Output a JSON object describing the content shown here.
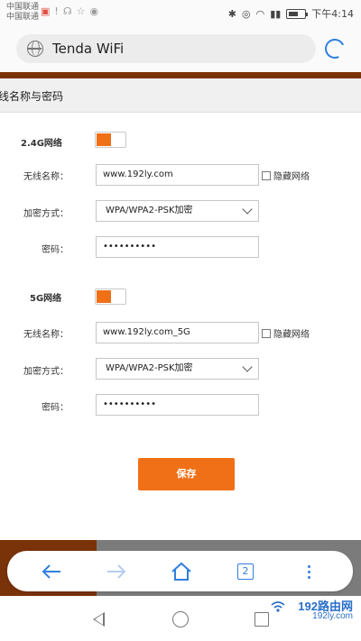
{
  "status_bar": {
    "carrier1": "中国联通",
    "carrier2": "中国联通",
    "time": "下午4:14"
  },
  "browser": {
    "url_text": "Tenda WiFi",
    "tab_count": "2"
  },
  "page": {
    "section_title": "线名称与密码",
    "band_24": {
      "label": "2.4G网络",
      "enabled": true,
      "ssid_label": "无线名称：",
      "ssid_value": "www.192ly.com",
      "hide_label": "隐藏网络",
      "security_label": "加密方式：",
      "security_value": "WPA/WPA2-PSK加密",
      "password_label": "密码：",
      "password_value": "••••••••••"
    },
    "band_5": {
      "label": "5G网络",
      "enabled": true,
      "ssid_label": "无线名称：",
      "ssid_value": "www.192ly.com_5G",
      "hide_label": "隐藏网络",
      "security_label": "加密方式：",
      "security_value": "WPA/WPA2-PSK加密",
      "password_label": "密码：",
      "password_value": "••••••••••"
    },
    "save_label": "保存"
  },
  "watermark": {
    "title": "192路由网",
    "url": "192ly.com"
  },
  "colors": {
    "accent": "#f07018",
    "brand_brown": "#7a3208",
    "browser_blue": "#2f7fe0"
  }
}
